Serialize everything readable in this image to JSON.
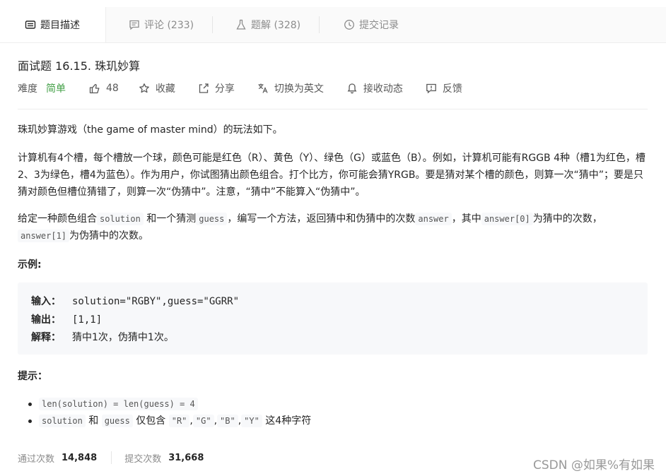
{
  "tabs": [
    {
      "label": "题目描述",
      "icon": "description-icon"
    },
    {
      "label": "评论 (233)",
      "icon": "comment-icon"
    },
    {
      "label": "题解 (328)",
      "icon": "flask-icon"
    },
    {
      "label": "提交记录",
      "icon": "clock-icon"
    }
  ],
  "problem": {
    "title": "面试题 16.15. 珠玑妙算",
    "difficulty_label": "难度",
    "difficulty": "简单",
    "likes": "48",
    "favorite": "收藏",
    "share": "分享",
    "switch_lang": "切换为英文",
    "notify": "接收动态",
    "feedback": "反馈"
  },
  "description": {
    "p1": "珠玑妙算游戏（the game of master mind）的玩法如下。",
    "p2": "计算机有4个槽，每个槽放一个球，颜色可能是红色（R）、黄色（Y）、绿色（G）或蓝色（B）。例如，计算机可能有RGGB 4种（槽1为红色，槽2、3为绿色，槽4为蓝色）。作为用户，你试图猜出颜色组合。打个比方，你可能会猜YRGB。要是猜对某个槽的颜色，则算一次“猜中”；要是只猜对颜色但槽位猜错了，则算一次“伪猜中”。注意，“猜中”不能算入“伪猜中”。",
    "p3_a": "给定一种颜色组合",
    "p3_code1": "solution",
    "p3_b": "和一个猜测",
    "p3_code2": "guess",
    "p3_c": "，编写一个方法，返回猜中和伪猜中的次数",
    "p3_code3": "answer",
    "p3_d": "，其中",
    "p3_code4": "answer[0]",
    "p3_e": "为猜中的次数，",
    "p3_code5": "answer[1]",
    "p3_f": "为伪猜中的次数。"
  },
  "example": {
    "heading": "示例:",
    "input_label": "输入：",
    "input_value": "solution=\"RGBY\",guess=\"GGRR\"",
    "output_label": "输出：",
    "output_value": "[1,1]",
    "explain_label": "解释：",
    "explain_value": "猜中1次，伪猜中1次。"
  },
  "hints": {
    "heading": "提示：",
    "h1_code": "len(solution) = len(guess) = 4",
    "h2_code1": "solution",
    "h2_and": "和",
    "h2_code2": "guess",
    "h2_text": "仅包含",
    "h2_code3": "\"R\"",
    "h2_code4": "\"G\"",
    "h2_code5": "\"B\"",
    "h2_code6": "\"Y\"",
    "h2_comma": ",",
    "h2_end": "这4种字符"
  },
  "stats": {
    "accepted_label": "通过次数",
    "accepted_value": "14,848",
    "submitted_label": "提交次数",
    "submitted_value": "31,668"
  },
  "watermark": "CSDN @如果%有如果"
}
